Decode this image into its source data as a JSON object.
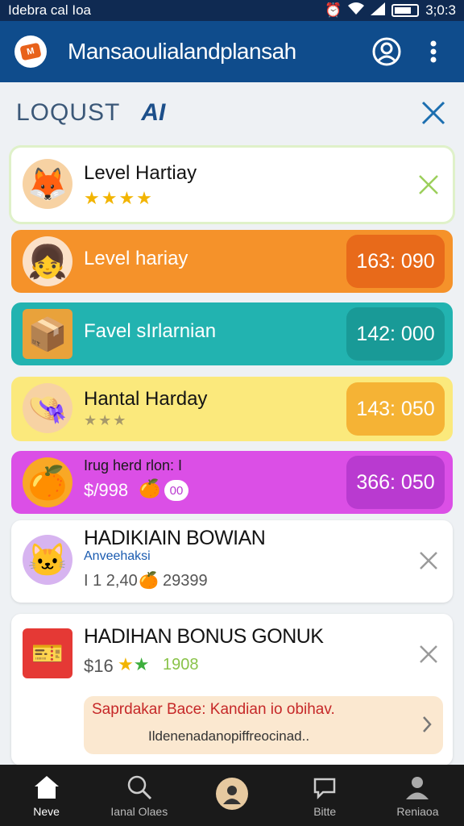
{
  "status_bar": {
    "carrier": "Idebra cal Ioa",
    "time": "3;0:3"
  },
  "app_bar": {
    "title": "Mansaoulialandplansah"
  },
  "sub_header": {
    "label": "LOQUST",
    "mark": "AI"
  },
  "cards": [
    {
      "title": "Level Hartiay",
      "stars": "★★★★",
      "bg": "#ffffff"
    },
    {
      "title": "Level hariay",
      "value": "163: 090",
      "bg": "#f5922a",
      "pill": "#e86a1a"
    },
    {
      "title": "Favel sIrlarnian",
      "value": "142: 000",
      "bg": "#22b3b0",
      "pill": "#199a97"
    },
    {
      "title": "Hantal Harday",
      "stars": "★★★",
      "value": "143: 050",
      "bg": "#fbe97c",
      "pill": "#f5b335"
    },
    {
      "title": "Irug herd rlon:   I",
      "sub": "$/998",
      "badge": "00",
      "value": "366: 050",
      "bg": "#db4fe6",
      "pill": "#b93ad0"
    },
    {
      "title": "HADIKIAIN BOWIAN",
      "link": "Anveehaksi",
      "sub": "I 1 2,40",
      "sub2": "29399",
      "bg": "#ffffff"
    },
    {
      "title": "HADIHAN BONUS GONUK",
      "sub": "$16",
      "sub2": "1908",
      "banner_title": "Saprdakar Bace: Kandian io obihav.",
      "banner_text": "Ildenenadanopiffreocinad..",
      "bg": "#ffffff"
    }
  ],
  "bottom_nav": [
    {
      "label": "Neve"
    },
    {
      "label": "Ianal Olaes"
    },
    {
      "label": ""
    },
    {
      "label": "Bitte"
    },
    {
      "label": "Reniaoa"
    }
  ]
}
